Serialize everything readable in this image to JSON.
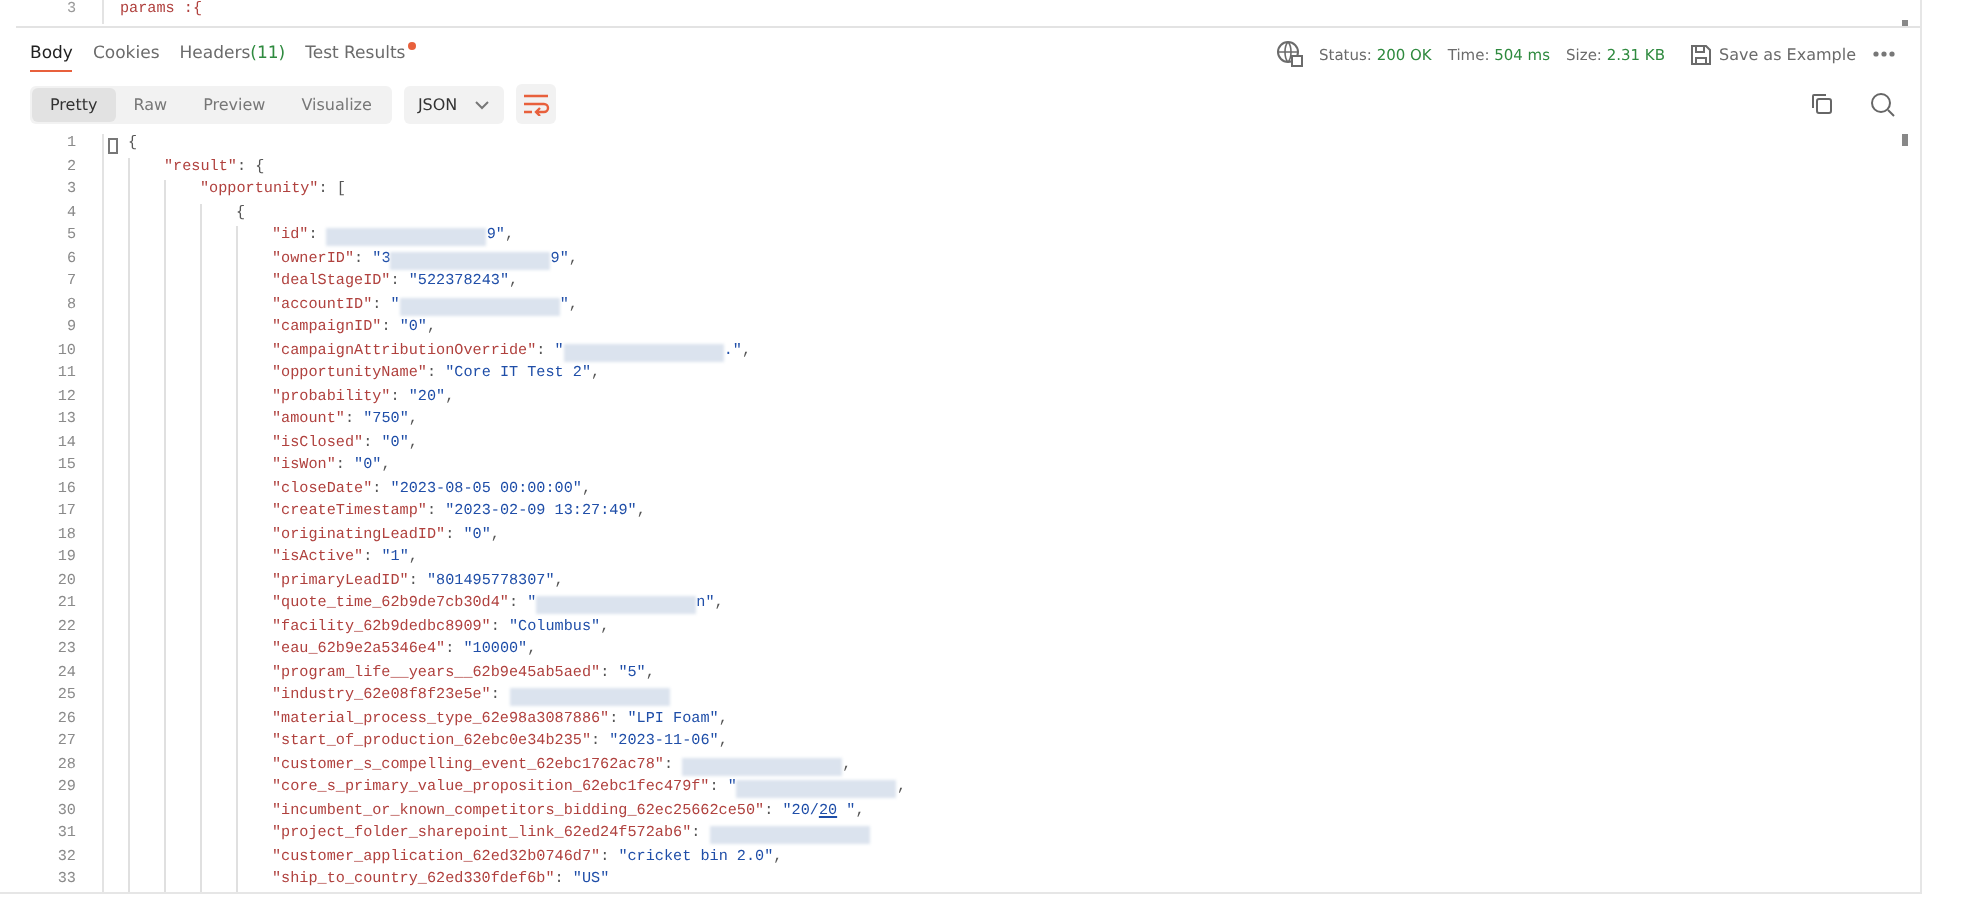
{
  "request_editor": {
    "lines": [
      {
        "num": "3",
        "text": "params :{"
      }
    ]
  },
  "response_tabs": [
    {
      "label": "Body",
      "selected": true,
      "dot": false
    },
    {
      "label": "Cookies",
      "selected": false,
      "dot": false
    },
    {
      "label": "Headers",
      "count": "(11)",
      "selected": false,
      "dot": false
    },
    {
      "label": "Test Results",
      "selected": false,
      "dot": true
    }
  ],
  "status": [
    {
      "label": "Status:",
      "value": "200 OK"
    },
    {
      "label": "Time:",
      "value": "504 ms"
    },
    {
      "label": "Size:",
      "value": "2.31 KB"
    }
  ],
  "save_button": "Save as Example",
  "view_modes": [
    {
      "label": "Pretty",
      "selected": true
    },
    {
      "label": "Raw",
      "selected": false
    },
    {
      "label": "Preview",
      "selected": false
    },
    {
      "label": "Visualize",
      "selected": false
    }
  ],
  "format_dropdown": "JSON",
  "code": [
    {
      "num": "1",
      "tokens": [
        {
          "kind": "punct",
          "text": "{"
        }
      ],
      "children": [
        {
          "num": "2",
          "tokens": [
            {
              "kind": "key",
              "text": "\"result\""
            },
            {
              "kind": "punct",
              "text": ": {"
            }
          ],
          "children": [
            {
              "num": "3",
              "tokens": [
                {
                  "kind": "key",
                  "text": "\"opportunity\""
                },
                {
                  "kind": "punct",
                  "text": ": ["
                }
              ],
              "children": [
                {
                  "num": "4",
                  "tokens": [
                    {
                      "kind": "punct",
                      "text": "{"
                    }
                  ],
                  "children": [
                    {
                      "num": "5",
                      "tokens": [
                        {
                          "kind": "key",
                          "text": "\"id\""
                        },
                        {
                          "kind": "punct",
                          "text": ": "
                        },
                        {
                          "kind": "redacted"
                        },
                        {
                          "kind": "str",
                          "text": "9\""
                        },
                        {
                          "kind": "punct",
                          "text": ","
                        }
                      ]
                    },
                    {
                      "num": "6",
                      "tokens": [
                        {
                          "kind": "key",
                          "text": "\"ownerID\""
                        },
                        {
                          "kind": "punct",
                          "text": ": "
                        },
                        {
                          "kind": "str",
                          "text": "\"3"
                        },
                        {
                          "kind": "redacted"
                        },
                        {
                          "kind": "str",
                          "text": "9\""
                        },
                        {
                          "kind": "punct",
                          "text": ","
                        }
                      ]
                    },
                    {
                      "num": "7",
                      "tokens": [
                        {
                          "kind": "key",
                          "text": "\"dealStageID\""
                        },
                        {
                          "kind": "punct",
                          "text": ": "
                        },
                        {
                          "kind": "str",
                          "text": "\"522378243\""
                        },
                        {
                          "kind": "punct",
                          "text": ","
                        }
                      ]
                    },
                    {
                      "num": "8",
                      "tokens": [
                        {
                          "kind": "key",
                          "text": "\"accountID\""
                        },
                        {
                          "kind": "punct",
                          "text": ": "
                        },
                        {
                          "kind": "str",
                          "text": "\""
                        },
                        {
                          "kind": "redacted"
                        },
                        {
                          "kind": "str",
                          "text": "\""
                        },
                        {
                          "kind": "punct",
                          "text": ","
                        }
                      ]
                    },
                    {
                      "num": "9",
                      "tokens": [
                        {
                          "kind": "key",
                          "text": "\"campaignID\""
                        },
                        {
                          "kind": "punct",
                          "text": ": "
                        },
                        {
                          "kind": "str",
                          "text": "\"0\""
                        },
                        {
                          "kind": "punct",
                          "text": ","
                        }
                      ]
                    },
                    {
                      "num": "10",
                      "tokens": [
                        {
                          "kind": "key",
                          "text": "\"campaignAttributionOverride\""
                        },
                        {
                          "kind": "punct",
                          "text": ": "
                        },
                        {
                          "kind": "str",
                          "text": "\""
                        },
                        {
                          "kind": "redacted"
                        },
                        {
                          "kind": "str",
                          "text": ".\""
                        },
                        {
                          "kind": "punct",
                          "text": ","
                        }
                      ]
                    },
                    {
                      "num": "11",
                      "tokens": [
                        {
                          "kind": "key",
                          "text": "\"opportunityName\""
                        },
                        {
                          "kind": "punct",
                          "text": ": "
                        },
                        {
                          "kind": "str",
                          "text": "\"Core IT Test 2\""
                        },
                        {
                          "kind": "punct",
                          "text": ","
                        }
                      ]
                    },
                    {
                      "num": "12",
                      "tokens": [
                        {
                          "kind": "key",
                          "text": "\"probability\""
                        },
                        {
                          "kind": "punct",
                          "text": ": "
                        },
                        {
                          "kind": "str",
                          "text": "\"20\""
                        },
                        {
                          "kind": "punct",
                          "text": ","
                        }
                      ]
                    },
                    {
                      "num": "13",
                      "tokens": [
                        {
                          "kind": "key",
                          "text": "\"amount\""
                        },
                        {
                          "kind": "punct",
                          "text": ": "
                        },
                        {
                          "kind": "str",
                          "text": "\"750\""
                        },
                        {
                          "kind": "punct",
                          "text": ","
                        }
                      ]
                    },
                    {
                      "num": "14",
                      "tokens": [
                        {
                          "kind": "key",
                          "text": "\"isClosed\""
                        },
                        {
                          "kind": "punct",
                          "text": ": "
                        },
                        {
                          "kind": "str",
                          "text": "\"0\""
                        },
                        {
                          "kind": "punct",
                          "text": ","
                        }
                      ]
                    },
                    {
                      "num": "15",
                      "tokens": [
                        {
                          "kind": "key",
                          "text": "\"isWon\""
                        },
                        {
                          "kind": "punct",
                          "text": ": "
                        },
                        {
                          "kind": "str",
                          "text": "\"0\""
                        },
                        {
                          "kind": "punct",
                          "text": ","
                        }
                      ]
                    },
                    {
                      "num": "16",
                      "tokens": [
                        {
                          "kind": "key",
                          "text": "\"closeDate\""
                        },
                        {
                          "kind": "punct",
                          "text": ": "
                        },
                        {
                          "kind": "str",
                          "text": "\"2023-08-05 00:00:00\""
                        },
                        {
                          "kind": "punct",
                          "text": ","
                        }
                      ]
                    },
                    {
                      "num": "17",
                      "tokens": [
                        {
                          "kind": "key",
                          "text": "\"createTimestamp\""
                        },
                        {
                          "kind": "punct",
                          "text": ": "
                        },
                        {
                          "kind": "str",
                          "text": "\"2023-02-09 13:27:49\""
                        },
                        {
                          "kind": "punct",
                          "text": ","
                        }
                      ]
                    },
                    {
                      "num": "18",
                      "tokens": [
                        {
                          "kind": "key",
                          "text": "\"originatingLeadID\""
                        },
                        {
                          "kind": "punct",
                          "text": ": "
                        },
                        {
                          "kind": "str",
                          "text": "\"0\""
                        },
                        {
                          "kind": "punct",
                          "text": ","
                        }
                      ]
                    },
                    {
                      "num": "19",
                      "tokens": [
                        {
                          "kind": "key",
                          "text": "\"isActive\""
                        },
                        {
                          "kind": "punct",
                          "text": ": "
                        },
                        {
                          "kind": "str",
                          "text": "\"1\""
                        },
                        {
                          "kind": "punct",
                          "text": ","
                        }
                      ]
                    },
                    {
                      "num": "20",
                      "tokens": [
                        {
                          "kind": "key",
                          "text": "\"primaryLeadID\""
                        },
                        {
                          "kind": "punct",
                          "text": ": "
                        },
                        {
                          "kind": "str",
                          "text": "\"801495778307\""
                        },
                        {
                          "kind": "punct",
                          "text": ","
                        }
                      ]
                    },
                    {
                      "num": "21",
                      "tokens": [
                        {
                          "kind": "key",
                          "text": "\"quote_time_62b9de7cb30d4\""
                        },
                        {
                          "kind": "punct",
                          "text": ": "
                        },
                        {
                          "kind": "str",
                          "text": "\""
                        },
                        {
                          "kind": "redacted"
                        },
                        {
                          "kind": "str",
                          "text": "n\""
                        },
                        {
                          "kind": "punct",
                          "text": ","
                        }
                      ]
                    },
                    {
                      "num": "22",
                      "tokens": [
                        {
                          "kind": "key",
                          "text": "\"facility_62b9dedbc8909\""
                        },
                        {
                          "kind": "punct",
                          "text": ": "
                        },
                        {
                          "kind": "str",
                          "text": "\"Columbus\""
                        },
                        {
                          "kind": "punct",
                          "text": ","
                        }
                      ]
                    },
                    {
                      "num": "23",
                      "tokens": [
                        {
                          "kind": "key",
                          "text": "\"eau_62b9e2a5346e4\""
                        },
                        {
                          "kind": "punct",
                          "text": ": "
                        },
                        {
                          "kind": "str",
                          "text": "\"10000\""
                        },
                        {
                          "kind": "punct",
                          "text": ","
                        }
                      ]
                    },
                    {
                      "num": "24",
                      "tokens": [
                        {
                          "kind": "key",
                          "text": "\"program_life__years__62b9e45ab5aed\""
                        },
                        {
                          "kind": "punct",
                          "text": ": "
                        },
                        {
                          "kind": "str",
                          "text": "\"5\""
                        },
                        {
                          "kind": "punct",
                          "text": ","
                        }
                      ]
                    },
                    {
                      "num": "25",
                      "tokens": [
                        {
                          "kind": "key",
                          "text": "\"industry_62e08f8f23e5e\""
                        },
                        {
                          "kind": "punct",
                          "text": ": "
                        },
                        {
                          "kind": "redacted"
                        }
                      ]
                    },
                    {
                      "num": "26",
                      "tokens": [
                        {
                          "kind": "key",
                          "text": "\"material_process_type_62e98a3087886\""
                        },
                        {
                          "kind": "punct",
                          "text": ": "
                        },
                        {
                          "kind": "str",
                          "text": "\"LPI Foam\""
                        },
                        {
                          "kind": "punct",
                          "text": ","
                        }
                      ]
                    },
                    {
                      "num": "27",
                      "tokens": [
                        {
                          "kind": "key",
                          "text": "\"start_of_production_62ebc0e34b235\""
                        },
                        {
                          "kind": "punct",
                          "text": ": "
                        },
                        {
                          "kind": "str",
                          "text": "\"2023-11-06\""
                        },
                        {
                          "kind": "punct",
                          "text": ","
                        }
                      ]
                    },
                    {
                      "num": "28",
                      "tokens": [
                        {
                          "kind": "key",
                          "text": "\"customer_s_compelling_event_62ebc1762ac78\""
                        },
                        {
                          "kind": "punct",
                          "text": ": "
                        },
                        {
                          "kind": "redacted"
                        },
                        {
                          "kind": "punct",
                          "text": ","
                        }
                      ]
                    },
                    {
                      "num": "29",
                      "tokens": [
                        {
                          "kind": "key",
                          "text": "\"core_s_primary_value_proposition_62ebc1fec479f\""
                        },
                        {
                          "kind": "punct",
                          "text": ": "
                        },
                        {
                          "kind": "str",
                          "text": "\""
                        },
                        {
                          "kind": "redacted"
                        },
                        {
                          "kind": "punct",
                          "text": ","
                        }
                      ]
                    },
                    {
                      "num": "30",
                      "tokens": [
                        {
                          "kind": "key",
                          "text": "\"incumbent_or_known_competitors_bidding_62ec25662ce50\""
                        },
                        {
                          "kind": "punct",
                          "text": ": "
                        },
                        {
                          "kind": "str",
                          "text": "\"20/"
                        },
                        {
                          "kind": "link",
                          "text": "20"
                        },
                        {
                          "kind": "str",
                          "text": " \""
                        },
                        {
                          "kind": "punct",
                          "text": ","
                        }
                      ]
                    },
                    {
                      "num": "31",
                      "tokens": [
                        {
                          "kind": "key",
                          "text": "\"project_folder_sharepoint_link_62ed24f572ab6\""
                        },
                        {
                          "kind": "punct",
                          "text": ": "
                        },
                        {
                          "kind": "redacted"
                        }
                      ]
                    },
                    {
                      "num": "32",
                      "tokens": [
                        {
                          "kind": "key",
                          "text": "\"customer_application_62ed32b0746d7\""
                        },
                        {
                          "kind": "punct",
                          "text": ": "
                        },
                        {
                          "kind": "str",
                          "text": "\"cricket bin 2.0\""
                        },
                        {
                          "kind": "punct",
                          "text": ","
                        }
                      ]
                    },
                    {
                      "num": "33",
                      "tokens": [
                        {
                          "kind": "key",
                          "text": "\"ship_to_country_62ed330fdef6b\""
                        },
                        {
                          "kind": "punct",
                          "text": ": "
                        },
                        {
                          "kind": "str",
                          "text": "\"US\""
                        }
                      ]
                    }
                  ]
                }
              ]
            }
          ]
        }
      ]
    }
  ]
}
